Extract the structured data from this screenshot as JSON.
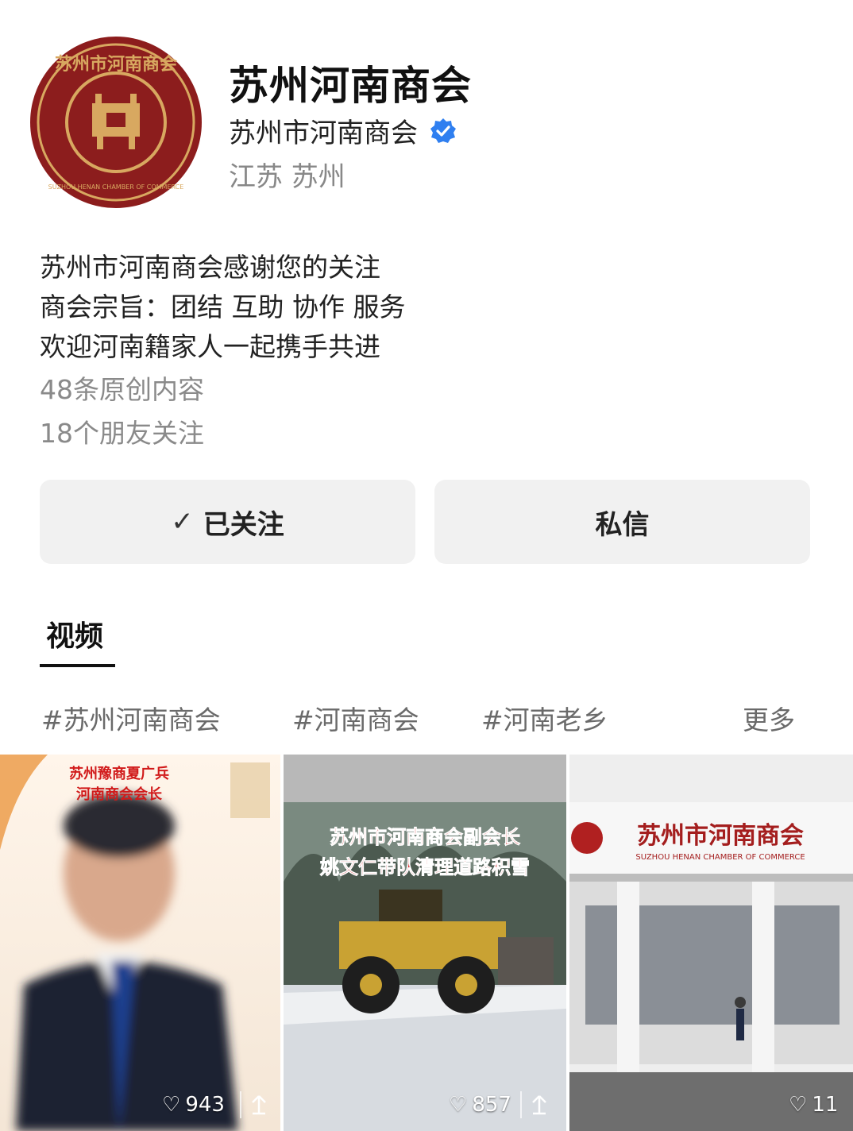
{
  "profile": {
    "name": "苏州河南商会",
    "account": "苏州市河南商会",
    "location": "江苏 苏州",
    "logo_text": "苏州市河南商会",
    "logo_subtext": "SUZHOU HENAN CHAMBER OF COMMERCE",
    "bio": [
      "苏州市河南商会感谢您的关注",
      "商会宗旨：团结 互助 协作 服务",
      "欢迎河南籍家人一起携手共进"
    ],
    "original_count": "48条原创内容",
    "friends_follow": "18个朋友关注"
  },
  "actions": {
    "follow_label": "已关注",
    "message_label": "私信"
  },
  "tabs": [
    "视频"
  ],
  "hashtags": [
    "#苏州河南商会",
    "#河南商会",
    "#河南老乡"
  ],
  "more_label": "更多",
  "videos": [
    {
      "caption": [
        "苏州豫商夏广兵",
        "河南商会会长"
      ],
      "likes": "943"
    },
    {
      "caption": [
        "苏州市河南商会副会长",
        "姚文仁带队清理道路积雪"
      ],
      "likes": "857"
    },
    {
      "caption": [
        "苏州市河南商会"
      ],
      "sign_subtext": "SUZHOU HENAN CHAMBER OF COMMERCE",
      "likes": "11"
    }
  ],
  "colors": {
    "logo_red": "#8c1d1d",
    "logo_gold": "#d8a860",
    "verify_blue": "#2f7ff0",
    "caption_red": "#d11a1a"
  },
  "icons": [
    "verified-badge-icon",
    "checkmark-icon",
    "heart-icon",
    "share-icon"
  ]
}
